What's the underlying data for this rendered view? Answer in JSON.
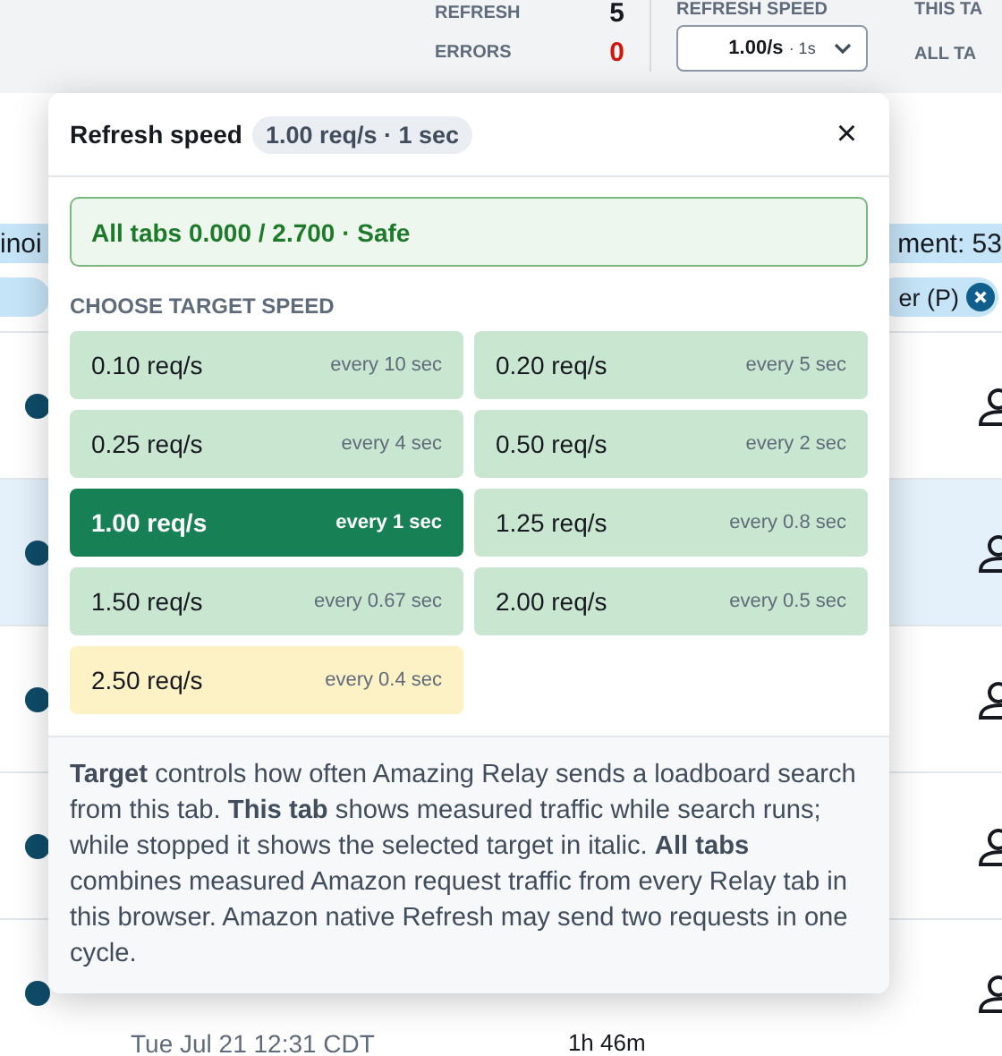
{
  "header": {
    "stats": [
      {
        "label": "REFRESH",
        "value": "5",
        "kind": "normal"
      },
      {
        "label": "ERRORS",
        "value": "0",
        "kind": "error"
      }
    ],
    "speed": {
      "label": "REFRESH SPEED",
      "value": "1.00/s",
      "unit": "· 1s"
    },
    "right_labels": [
      "THIS TA",
      "ALL TA"
    ]
  },
  "background": {
    "banner_left": "inoi",
    "banner_right": "ment: 53",
    "chip_right": "er (P)",
    "rows": [
      {
        "highlighted": false
      },
      {
        "highlighted": true
      },
      {
        "highlighted": false
      },
      {
        "highlighted": false
      },
      {
        "highlighted": false,
        "date": "Tue Jul 21 12:31 CDT",
        "duration": "1h 46m"
      }
    ]
  },
  "popover": {
    "title": "Refresh speed",
    "current": "1.00 req/s · 1 sec",
    "close": "×",
    "status": "All tabs 0.000 / 2.700 · Safe",
    "section": "CHOOSE TARGET SPEED",
    "options": [
      {
        "rate": "0.10 req/s",
        "interval": "every 10 sec",
        "selected": false,
        "kind": "safe"
      },
      {
        "rate": "0.20 req/s",
        "interval": "every 5 sec",
        "selected": false,
        "kind": "safe"
      },
      {
        "rate": "0.25 req/s",
        "interval": "every 4 sec",
        "selected": false,
        "kind": "safe"
      },
      {
        "rate": "0.50 req/s",
        "interval": "every 2 sec",
        "selected": false,
        "kind": "safe"
      },
      {
        "rate": "1.00 req/s",
        "interval": "every 1 sec",
        "selected": true,
        "kind": "safe"
      },
      {
        "rate": "1.25 req/s",
        "interval": "every 0.8 sec",
        "selected": false,
        "kind": "safe"
      },
      {
        "rate": "1.50 req/s",
        "interval": "every 0.67 sec",
        "selected": false,
        "kind": "safe"
      },
      {
        "rate": "2.00 req/s",
        "interval": "every 0.5 sec",
        "selected": false,
        "kind": "safe"
      },
      {
        "rate": "2.50 req/s",
        "interval": "every 0.4 sec",
        "selected": false,
        "kind": "caution"
      }
    ],
    "help": "**Target** controls how often Amazing Relay sends a loadboard search from this tab. **This tab** shows measured traffic while search runs; while stopped it shows the selected target in italic. **All tabs** combines measured Amazon request traffic from every Relay tab in this browser. Amazon native Refresh may send two requests in one cycle."
  }
}
